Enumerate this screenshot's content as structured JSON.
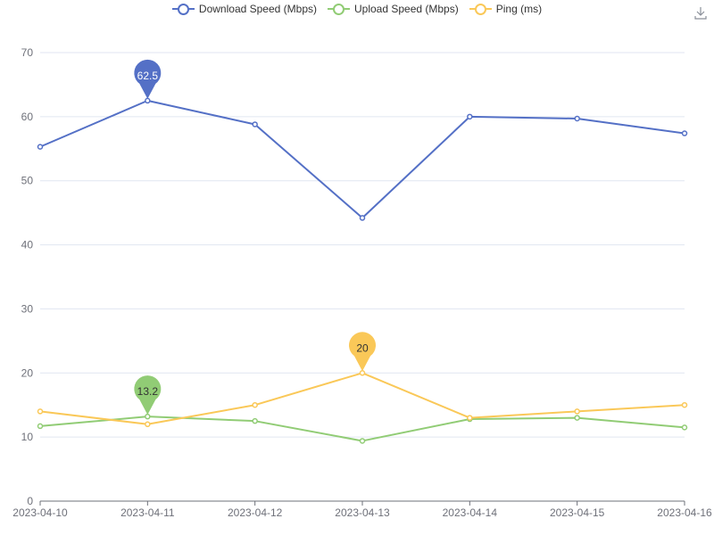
{
  "legend": {
    "download_label": "Download Speed (Mbps)",
    "upload_label": "Upload Speed (Mbps)",
    "ping_label": "Ping (ms)"
  },
  "colors": {
    "download": "#5470c6",
    "upload": "#91cc75",
    "ping": "#fac858",
    "grid": "#e0e6f1",
    "axis": "#6e7079"
  },
  "toolbar": {
    "save_icon": "download-icon"
  },
  "chart_data": {
    "type": "line",
    "x": [
      "2023-04-10",
      "2023-04-11",
      "2023-04-12",
      "2023-04-13",
      "2023-04-14",
      "2023-04-15",
      "2023-04-16"
    ],
    "ylim": [
      0,
      70
    ],
    "yticks": [
      0,
      10,
      20,
      30,
      40,
      50,
      60,
      70
    ],
    "grid": true,
    "legend_position": "top-center",
    "series": [
      {
        "name": "Download Speed (Mbps)",
        "color_key": "download",
        "values": [
          55.3,
          62.5,
          58.8,
          44.2,
          60.0,
          59.7,
          57.4
        ],
        "max_marker": {
          "index": 1,
          "label": "62.5"
        }
      },
      {
        "name": "Upload Speed (Mbps)",
        "color_key": "upload",
        "values": [
          11.7,
          13.2,
          12.5,
          9.4,
          12.8,
          13.0,
          11.5
        ],
        "max_marker": {
          "index": 1,
          "label": "13.2"
        }
      },
      {
        "name": "Ping (ms)",
        "color_key": "ping",
        "values": [
          14,
          12,
          15,
          20,
          13,
          14,
          15
        ],
        "max_marker": {
          "index": 3,
          "label": "20"
        }
      }
    ]
  }
}
